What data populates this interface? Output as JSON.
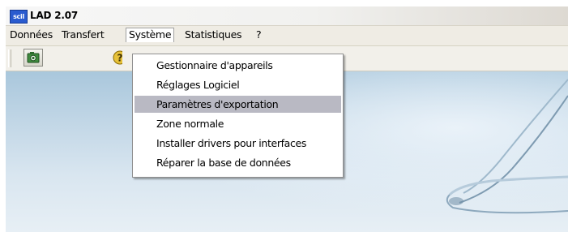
{
  "window": {
    "app_icon_text": "scil",
    "title": "LAD 2.07"
  },
  "menubar": {
    "items": [
      {
        "label": "Données"
      },
      {
        "label": "Transfert"
      },
      {
        "label": "Système"
      },
      {
        "label": "Statistiques"
      },
      {
        "label": "?"
      }
    ],
    "active_index": 2
  },
  "toolbar": {
    "buttons": [
      {
        "icon": "camera-icon"
      },
      {
        "icon": "help-icon"
      }
    ]
  },
  "dropdown": {
    "items": [
      {
        "label": "Gestionnaire d'appareils"
      },
      {
        "label": "Réglages Logiciel"
      },
      {
        "label": "Paramètres d'exportation"
      },
      {
        "label": "Zone normale"
      },
      {
        "label": "Installer drivers pour interfaces"
      },
      {
        "label": "Réparer la base de données"
      }
    ],
    "highlighted_index": 2
  },
  "colors": {
    "highlight": "#b9b9c3",
    "menu_bg": "#efece4",
    "background_sky": "#c4d8e7"
  }
}
